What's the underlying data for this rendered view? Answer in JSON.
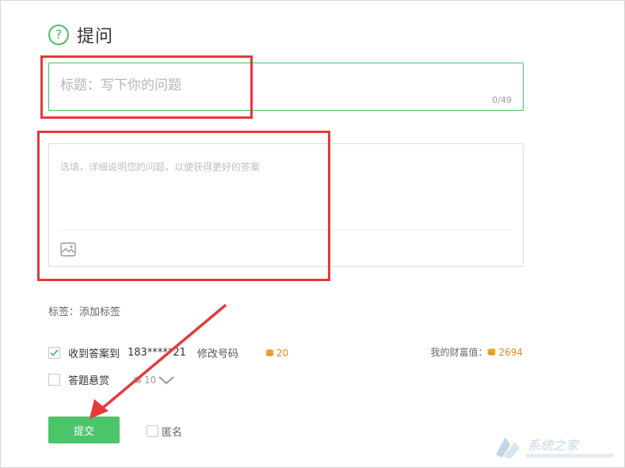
{
  "header": {
    "icon": "question-circle-icon",
    "title": "提问"
  },
  "title_field": {
    "placeholder": "标题：写下你的问题",
    "value": "",
    "counter": "0/49"
  },
  "description_field": {
    "placeholder": "选填，详细说明您的问题，以便获得更好的答案",
    "value": "",
    "image_icon": "image-icon"
  },
  "tags": {
    "label": "标签：",
    "add_label": "添加标签"
  },
  "notify": {
    "checked": true,
    "label": "收到答案到",
    "phone": "183*****21",
    "modify_label": "修改号码",
    "cost": "20"
  },
  "wealth": {
    "label": "我的财富值：",
    "value": "2694"
  },
  "reward": {
    "checked": false,
    "label": "答题悬赏",
    "amount": "10"
  },
  "submit": {
    "label": "提交"
  },
  "anonymous": {
    "checked": false,
    "label": "匿名"
  },
  "colors": {
    "accent": "#4cc46a",
    "highlight": "#e5393a",
    "coin": "#f0a32a"
  }
}
